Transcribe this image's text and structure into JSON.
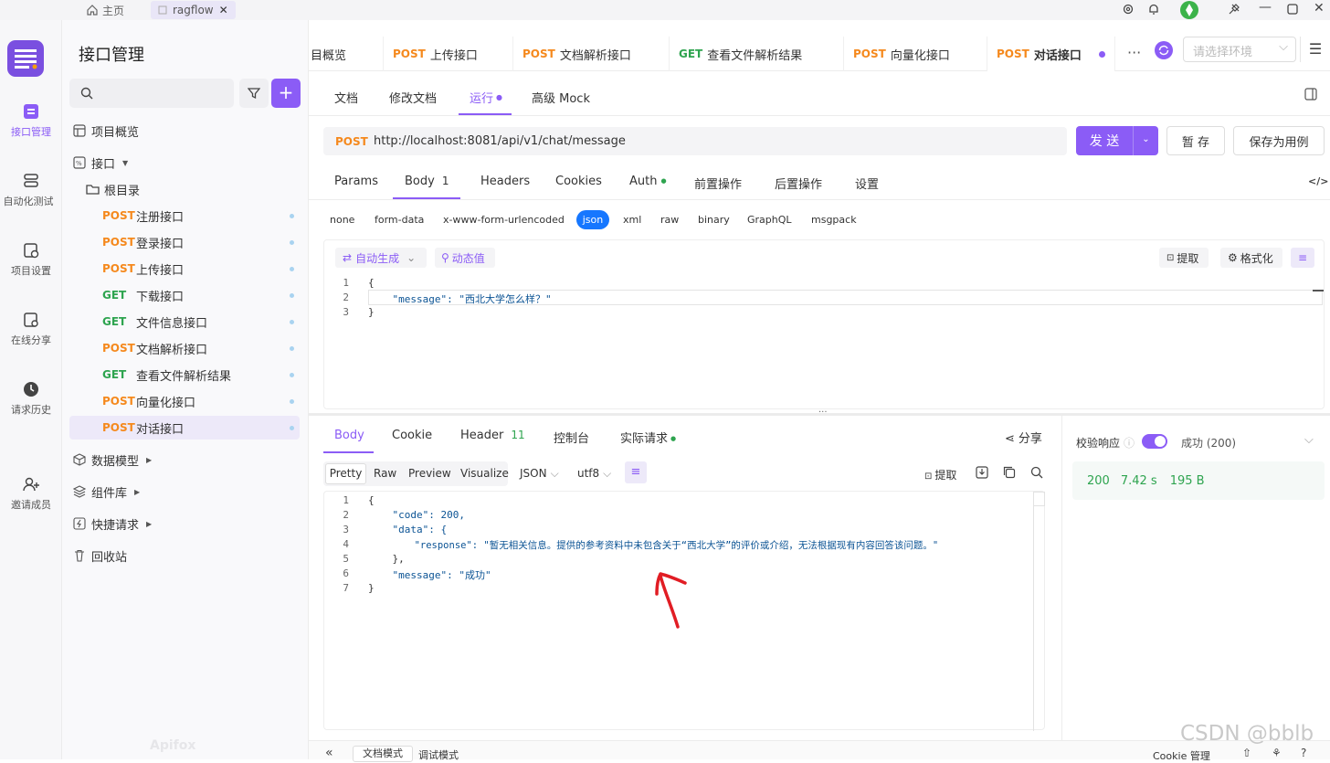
{
  "topbar": {
    "home_label": "主页",
    "project_tab": "ragflow"
  },
  "rail": {
    "items": [
      {
        "label": "接口管理",
        "icon": "api-manage-icon"
      },
      {
        "label": "自动化测试",
        "icon": "automation-test-icon"
      },
      {
        "label": "项目设置",
        "icon": "project-settings-icon"
      },
      {
        "label": "在线分享",
        "icon": "online-share-icon"
      },
      {
        "label": "请求历史",
        "icon": "request-history-icon"
      },
      {
        "label": "邀请成员",
        "icon": "invite-member-icon"
      }
    ]
  },
  "sidebar": {
    "title": "接口管理",
    "overview": "项目概览",
    "interfaces": "接口",
    "root": "根目录",
    "apis": [
      {
        "method": "POST",
        "name": "注册接口"
      },
      {
        "method": "POST",
        "name": "登录接口"
      },
      {
        "method": "POST",
        "name": "上传接口"
      },
      {
        "method": "GET",
        "name": "下载接口"
      },
      {
        "method": "GET",
        "name": "文件信息接口"
      },
      {
        "method": "POST",
        "name": "文档解析接口"
      },
      {
        "method": "GET",
        "name": "查看文件解析结果"
      },
      {
        "method": "POST",
        "name": "向量化接口"
      },
      {
        "method": "POST",
        "name": "对话接口"
      }
    ],
    "data_model": "数据模型",
    "components": "组件库",
    "quick_request": "快捷请求",
    "recycle_bin": "回收站",
    "watermark": "Apifox"
  },
  "tabs": [
    {
      "method": "",
      "label": "目概览"
    },
    {
      "method": "POST",
      "label": "上传接口"
    },
    {
      "method": "POST",
      "label": "文档解析接口"
    },
    {
      "method": "GET",
      "label": "查看文件解析结果"
    },
    {
      "method": "POST",
      "label": "向量化接口"
    },
    {
      "method": "POST",
      "label": "对话接口"
    }
  ],
  "env_placeholder": "请选择环境",
  "subtabs": {
    "doc": "文档",
    "edit": "修改文档",
    "run": "运行",
    "mock": "高级 Mock"
  },
  "request": {
    "method": "POST",
    "url": "http://localhost:8081/api/v1/chat/message",
    "send": "发 送",
    "save": "暂 存",
    "save_case": "保存为用例"
  },
  "param_tabs": {
    "params": "Params",
    "body": "Body",
    "body_count": "1",
    "headers": "Headers",
    "cookies": "Cookies",
    "auth": "Auth",
    "pre": "前置操作",
    "post": "后置操作",
    "settings": "设置"
  },
  "body_types": [
    "none",
    "form-data",
    "x-www-form-urlencoded",
    "json",
    "xml",
    "raw",
    "binary",
    "GraphQL",
    "msgpack"
  ],
  "body_tools": {
    "auto": "自动生成",
    "dynamic": "动态值",
    "extract": "提取",
    "format": "格式化"
  },
  "request_body": [
    {
      "n": "1",
      "text": "{"
    },
    {
      "n": "2",
      "text": "    \"message\": \"西北大学怎么样？\""
    },
    {
      "n": "3",
      "text": "}"
    }
  ],
  "response_tabs": {
    "body": "Body",
    "cookie": "Cookie",
    "header": "Header",
    "header_count": "11",
    "console": "控制台",
    "actual": "实际请求",
    "share": "分享"
  },
  "response_view": {
    "pretty": "Pretty",
    "raw": "Raw",
    "preview": "Preview",
    "visualize": "Visualize",
    "json": "JSON",
    "encoding": "utf8",
    "extract": "提取"
  },
  "response_body": [
    {
      "n": "1",
      "text": "{"
    },
    {
      "n": "2",
      "text": "    \"code\": 200,"
    },
    {
      "n": "3",
      "text": "    \"data\": {"
    },
    {
      "n": "4",
      "text": "        \"response\": \"暂无相关信息。提供的参考资料中未包含关于“西北大学”的评价或介绍，无法根据现有内容回答该问题。\""
    },
    {
      "n": "5",
      "text": "    },"
    },
    {
      "n": "6",
      "text": "    \"message\": \"成功\""
    },
    {
      "n": "7",
      "text": "}"
    }
  ],
  "validation": {
    "label": "校验响应",
    "status": "成功 (200)",
    "code": "200",
    "time": "7.42 s",
    "size": "195 B"
  },
  "footer": {
    "doc_mode": "文档模式",
    "debug_mode": "调试模式",
    "cookie": "Cookie 管理"
  },
  "watermark": "CSDN @bblb",
  "colors": {
    "accent": "#8b5cf6",
    "post": "#f5891d",
    "get": "#2ea44f",
    "annotation": "#e11d24"
  }
}
